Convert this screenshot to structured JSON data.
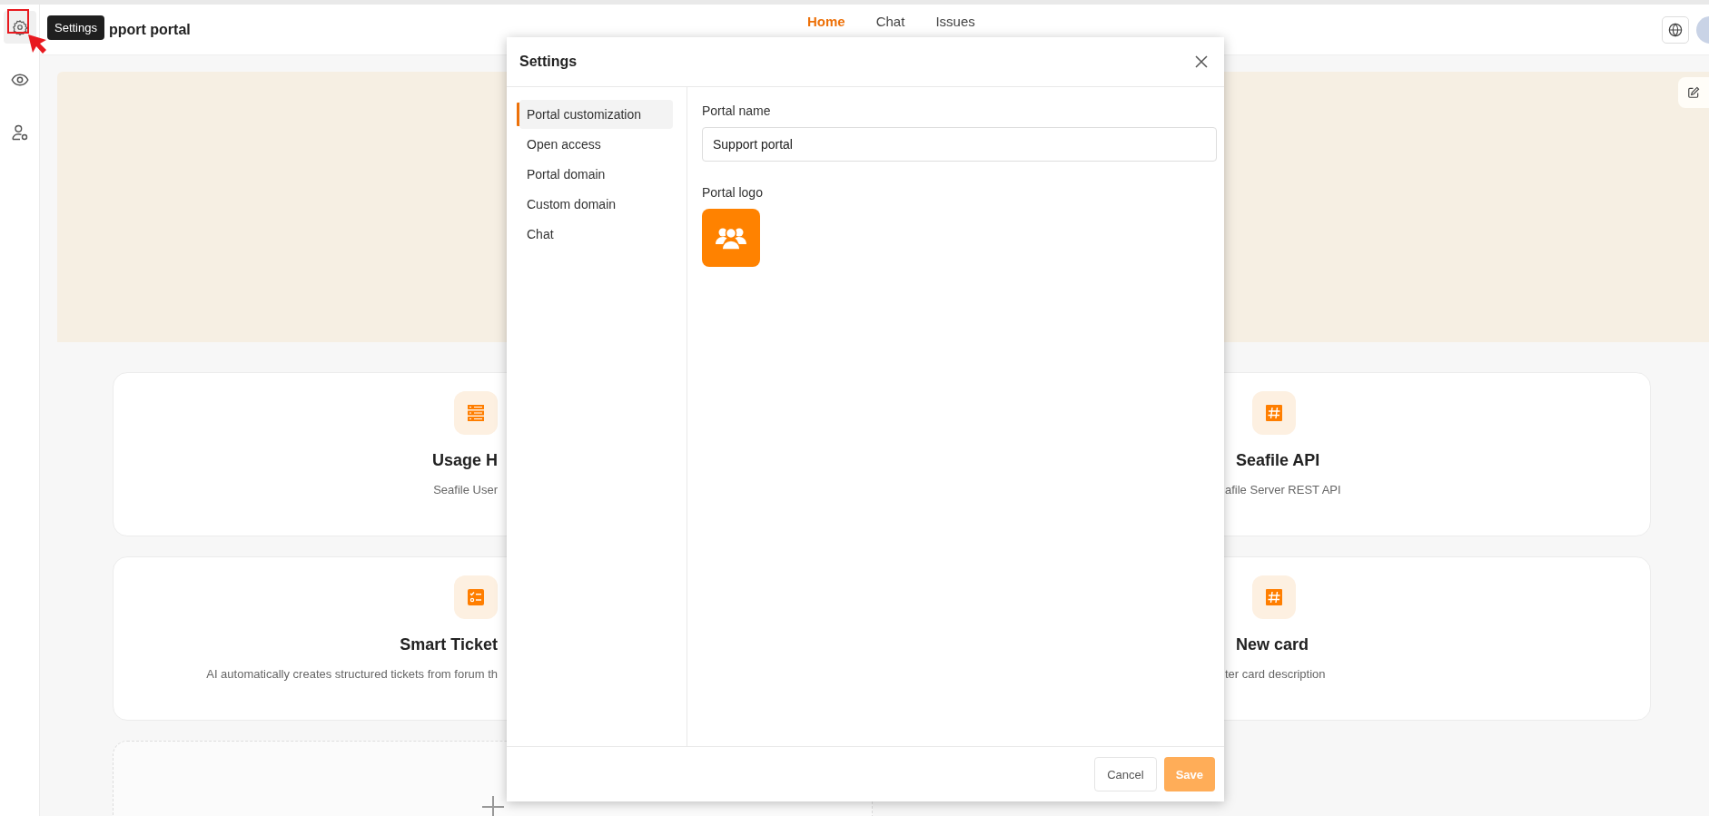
{
  "sidebar": {
    "items": [
      {
        "kind": "settings",
        "selected": true
      },
      {
        "kind": "preview",
        "selected": false
      },
      {
        "kind": "members",
        "selected": false
      }
    ]
  },
  "tooltip": {
    "text": "Settings"
  },
  "header": {
    "title": "pport portal",
    "nav": [
      {
        "label": "Home",
        "selected": true
      },
      {
        "label": "Chat",
        "selected": false
      },
      {
        "label": "Issues",
        "selected": false
      }
    ]
  },
  "cards": [
    {
      "kind": "server",
      "title": "Usage H",
      "description": "Seafile User"
    },
    {
      "kind": "hash",
      "title": "Seafile API",
      "description": "afile Server REST API"
    },
    {
      "kind": "checklist",
      "title": "Smart Ticket",
      "description": "AI automatically creates structured tickets from forum th"
    },
    {
      "kind": "hash",
      "title": "New card",
      "description": "ter card description"
    }
  ],
  "dialog": {
    "title": "Settings",
    "nav": [
      {
        "label": "Portal customization",
        "selected": true
      },
      {
        "label": "Open access",
        "selected": false
      },
      {
        "label": "Portal domain",
        "selected": false
      },
      {
        "label": "Custom domain",
        "selected": false
      },
      {
        "label": "Chat",
        "selected": false
      }
    ],
    "portal_name": {
      "label": "Portal name",
      "value": "Support portal"
    },
    "portal_logo": {
      "label": "Portal logo"
    },
    "buttons": [
      {
        "kind": "cancel",
        "label": "Cancel",
        "disabled": false
      },
      {
        "kind": "save",
        "label": "Save",
        "disabled": true
      }
    ]
  }
}
